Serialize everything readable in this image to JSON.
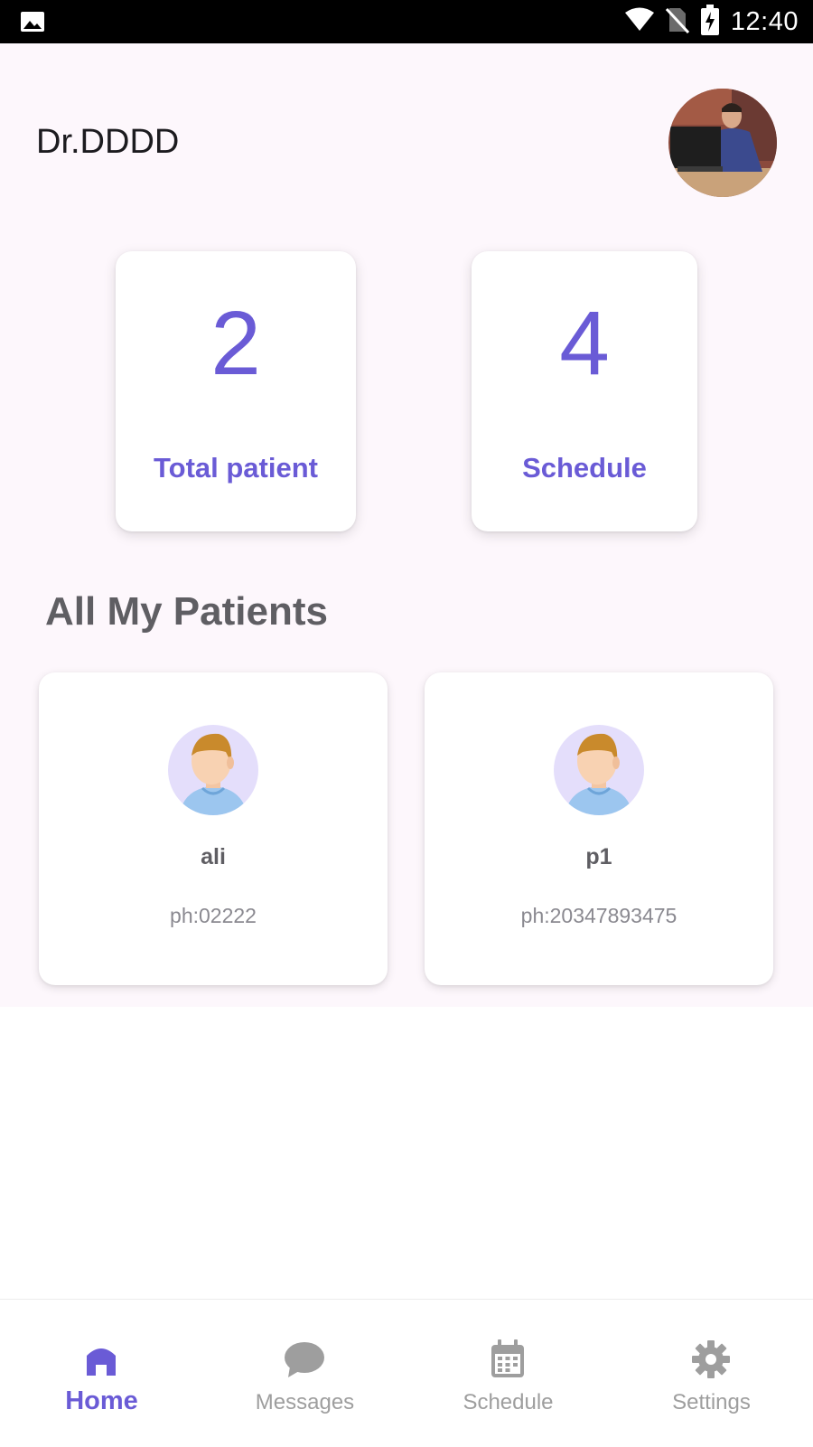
{
  "status_bar": {
    "time": "12:40"
  },
  "header": {
    "doctor_name": "Dr.DDDD"
  },
  "stats": [
    {
      "value": "2",
      "label": "Total patient"
    },
    {
      "value": "4",
      "label": "Schedule"
    }
  ],
  "patients_section": {
    "title": "All My Patients",
    "patients": [
      {
        "name": "ali",
        "phone": "ph:02222"
      },
      {
        "name": "p1",
        "phone": "ph:20347893475"
      }
    ]
  },
  "bottom_nav": {
    "items": [
      {
        "label": "Home",
        "icon": "home-icon",
        "active": true
      },
      {
        "label": "Messages",
        "icon": "chat-bubble-icon",
        "active": false
      },
      {
        "label": "Schedule",
        "icon": "calendar-icon",
        "active": false
      },
      {
        "label": "Settings",
        "icon": "gear-icon",
        "active": false
      }
    ]
  },
  "colors": {
    "accent": "#6a5bd6",
    "background": "#fdf7fc",
    "inactive": "#9e9e9e"
  }
}
